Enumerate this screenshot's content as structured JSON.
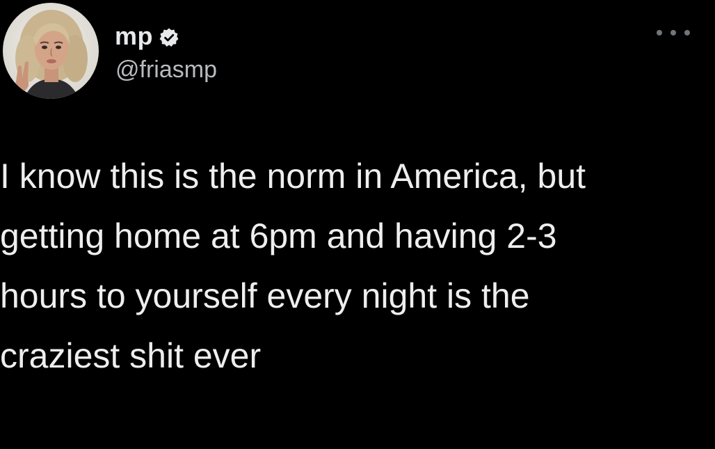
{
  "author": {
    "display_name": "mp",
    "handle": "@friasmp",
    "verified": true
  },
  "tweet": {
    "text_lines": [
      "I know this is the norm in America, but",
      "getting home at 6pm and having 2-3",
      "hours to yourself every night is the",
      "craziest shit ever"
    ]
  },
  "icons": {
    "verified": "verified-badge-icon",
    "more": "more-options-icon"
  },
  "colors": {
    "background": "#000000",
    "text": "#e7e9ea",
    "handle": "#b8bcc0",
    "more_dots": "#6f767b"
  }
}
